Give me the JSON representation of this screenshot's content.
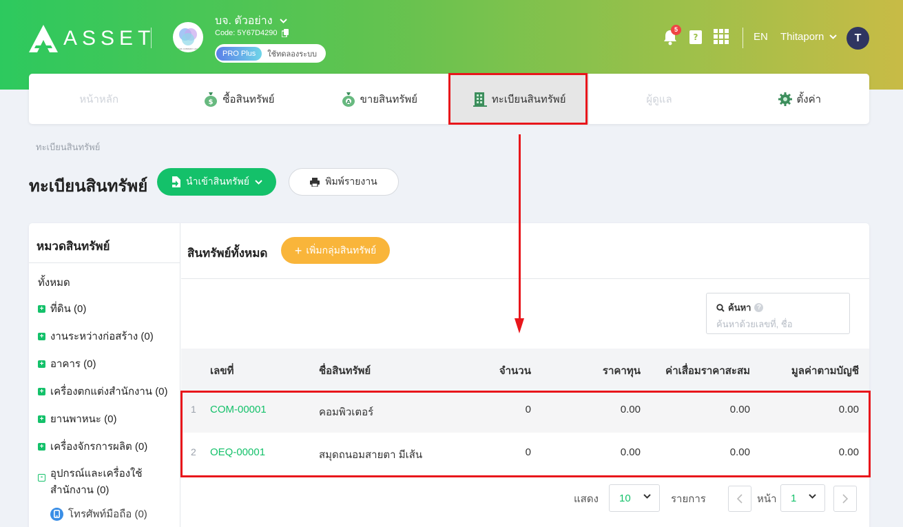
{
  "header": {
    "logo_text": "ASSET",
    "company_name": "บจ. ตัวอย่าง",
    "company_code": "Code: 5Y67D4290",
    "company_logo_text": "YOUR COMPANY LOGO",
    "plan_badge": "PRO Plus",
    "plan_trial": "ใช้ทดลองระบบ",
    "notification_count": "5",
    "language": "EN",
    "user_name": "Thitaporn",
    "avatar_initial": "T"
  },
  "nav": {
    "items": [
      {
        "label": "หน้าหลัก",
        "icon": "home-icon",
        "state": "disabled"
      },
      {
        "label": "ซื้อสินทรัพย์",
        "icon": "money-bag-icon",
        "state": "normal"
      },
      {
        "label": "ขายสินทรัพย์",
        "icon": "money-bag-sell-icon",
        "state": "normal"
      },
      {
        "label": "ทะเบียนสินทรัพย์",
        "icon": "building-icon",
        "state": "active"
      },
      {
        "label": "ผู้ดูแล",
        "icon": "user-icon",
        "state": "disabled"
      },
      {
        "label": "ตั้งค่า",
        "icon": "gear-icon",
        "state": "normal"
      }
    ]
  },
  "page": {
    "breadcrumb": "ทะเบียนสินทรัพย์",
    "title": "ทะเบียนสินทรัพย์",
    "import_button": "นำเข้าสินทรัพย์",
    "print_button": "พิมพ์รายงาน"
  },
  "sidebar": {
    "title": "หมวดสินทรัพย์",
    "all_label": "ทั้งหมด",
    "categories": [
      {
        "label": "ที่ดิน (0)"
      },
      {
        "label": "งานระหว่างก่อสร้าง (0)"
      },
      {
        "label": "อาคาร (0)"
      },
      {
        "label": "เครื่องตกแต่งสำนักงาน (0)"
      },
      {
        "label": "ยานพาหนะ (0)"
      },
      {
        "label": "เครื่องจักรการผลิต (0)"
      }
    ],
    "expanded_category": {
      "line1": "อุปกรณ์และเครื่องใช้",
      "line2": "สำนักงาน (0)"
    },
    "sub_category": "โทรศัพท์มือถือ (0)"
  },
  "main": {
    "heading": "สินทรัพย์ทั้งหมด",
    "add_group_button": "เพิ่มกลุ่มสินทรัพย์",
    "search_label": "ค้นหา",
    "search_placeholder": "ค้นหาด้วยเลขที่, ชื่อ",
    "columns": [
      "เลขที่",
      "ชื่อสินทรัพย์",
      "จำนวน",
      "ราคาทุน",
      "ค่าเสื่อมราคาสะสม",
      "มูลค่าตามบัญชี"
    ],
    "rows": [
      {
        "index": "1",
        "code": "COM-00001",
        "name": "คอมพิวเตอร์",
        "qty": "0",
        "cost": "0.00",
        "depreciation": "0.00",
        "book_value": "0.00"
      },
      {
        "index": "2",
        "code": "OEQ-00001",
        "name": "สมุดถนอมสายตา มีเส้น",
        "qty": "0",
        "cost": "0.00",
        "depreciation": "0.00",
        "book_value": "0.00"
      }
    ]
  },
  "pager": {
    "show_label": "แสดง",
    "page_size": "10",
    "items_label": "รายการ",
    "page_label": "หน้า",
    "page_number": "1"
  },
  "colors": {
    "brand_green": "#14c16a",
    "accent_orange": "#f9b53a",
    "annotation_red": "#e8161b"
  }
}
